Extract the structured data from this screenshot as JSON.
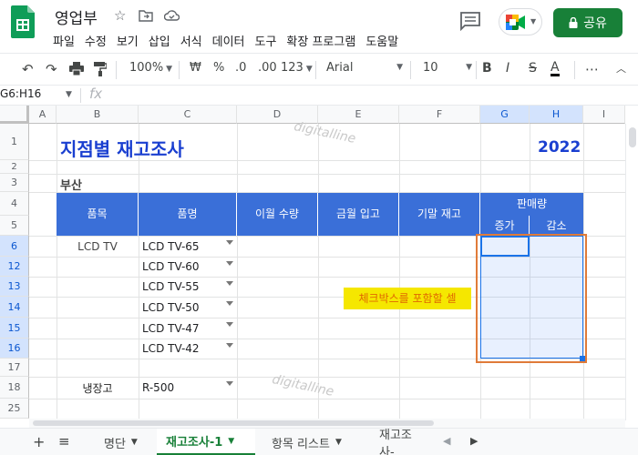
{
  "header": {
    "doc_title": "영업부",
    "menu": [
      "파일",
      "수정",
      "보기",
      "삽입",
      "서식",
      "데이터",
      "도구",
      "확장 프로그램",
      "도움말"
    ],
    "share_label": "공유"
  },
  "toolbar": {
    "zoom": "100%",
    "currency": "₩",
    "percent": "%",
    "dec_less": ".0",
    "dec_more": ".00",
    "format_more": "123",
    "font": "Arial",
    "font_size": "10",
    "bold": "B",
    "italic": "I",
    "strike": "S",
    "text_color": "A",
    "more": "⋯"
  },
  "formula_bar": {
    "name_box": "G6:H16",
    "fx": "fx"
  },
  "columns": [
    "A",
    "B",
    "C",
    "D",
    "E",
    "F",
    "G",
    "H",
    "I"
  ],
  "rows": [
    "1",
    "2",
    "3",
    "4",
    "5",
    "6",
    "12",
    "13",
    "14",
    "15",
    "16",
    "17",
    "18",
    "25"
  ],
  "sheet": {
    "title": "지점별 재고조사",
    "year": "2022",
    "branch": "부산",
    "headers": {
      "item": "품목",
      "product": "품명",
      "prev_qty": "이월 수량",
      "this_in": "금월 입고",
      "end_stock": "기말 재고",
      "sales": "판매량",
      "increase": "증가",
      "decrease": "감소"
    },
    "item_tv": "LCD TV",
    "products_tv": [
      "LCD TV-65",
      "LCD TV-60",
      "LCD TV-55",
      "LCD TV-50",
      "LCD TV-47",
      "LCD TV-42"
    ],
    "item_fridge": "냉장고",
    "product_fridge": "R-500",
    "note": "체크박스를 포함할 셀",
    "watermark": "digitalline"
  },
  "tabs": [
    {
      "label": "명단",
      "active": false
    },
    {
      "label": "재고조사-1",
      "active": true
    },
    {
      "label": "항목 리스트",
      "active": false
    },
    {
      "label": "재고조사-",
      "active": false
    }
  ],
  "colors": {
    "header_blue": "#3a6fd8",
    "title_blue": "#1a3fd0",
    "share_green": "#188038",
    "selection_border": "#1a73e8",
    "highlight_orange": "#e07b39",
    "note_yellow": "#f5e700"
  }
}
